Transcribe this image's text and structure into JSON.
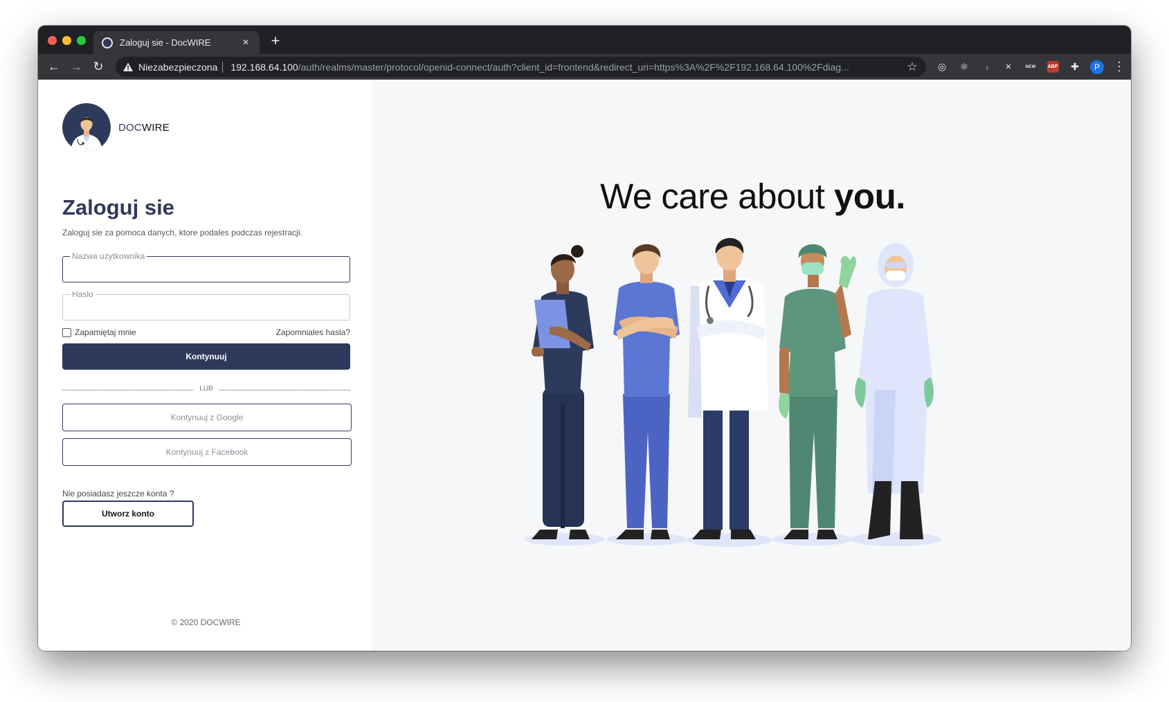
{
  "browser": {
    "tab": {
      "title": "Zaloguj sie - DocWIRE",
      "close": "×"
    },
    "new_tab": "+",
    "nav": {
      "back": "←",
      "forward": "→",
      "reload": "↻"
    },
    "address": {
      "security_label": "Niezabezpieczona",
      "host": "192.168.64.100",
      "path": "/auth/realms/master/protocol/openid-connect/auth?client_id=frontend&redirect_uri=https%3A%2F%2F192.168.64.100%2Fdiag..."
    },
    "star": "☆",
    "extensions": [
      {
        "name": "target-extension-icon",
        "glyph": "◎"
      },
      {
        "name": "react-devtools-icon",
        "glyph": "⚛"
      },
      {
        "name": "dark-reader-icon",
        "glyph": "◑"
      },
      {
        "name": "x-extension-icon",
        "glyph": "✕"
      },
      {
        "name": "new-badge-extension-icon",
        "glyph": "NEW"
      },
      {
        "name": "adblock-plus-icon",
        "glyph": "ABP"
      },
      {
        "name": "puzzle-extensions-icon",
        "glyph": "✚"
      }
    ],
    "profile_initial": "P",
    "menu": "⋮"
  },
  "login": {
    "brand_prefix": "DOC",
    "brand_suffix": "WIRE",
    "title": "Zaloguj sie",
    "subtitle": "Zaloguj sie za pomoca danych, ktore podales podczas rejestracji.",
    "username_label": "Nazwa uzytkownika",
    "username_value": "",
    "password_label": "Haslo",
    "password_value": "",
    "remember_label": "Zapamiętaj mnie",
    "remember_checked": false,
    "forgot_label": "Zapomniales hasla?",
    "submit_label": "Kontynuuj",
    "divider_label": "LUB",
    "google_label": "Kontynuuj z Google",
    "facebook_label": "Kontynuuj z Facebook",
    "no_account_text": "Nie posiadasz jeszcze konta ?",
    "create_account_label": "Utworz konto",
    "copyright": "© 2020 DOCWIRE"
  },
  "hero": {
    "headline_light": "We care about ",
    "headline_bold": "you."
  },
  "colors": {
    "primary": "#2e3a5b",
    "hero_background": "#f6f7f9",
    "chrome_dark": "#202124",
    "chrome_toolbar": "#35363a"
  }
}
